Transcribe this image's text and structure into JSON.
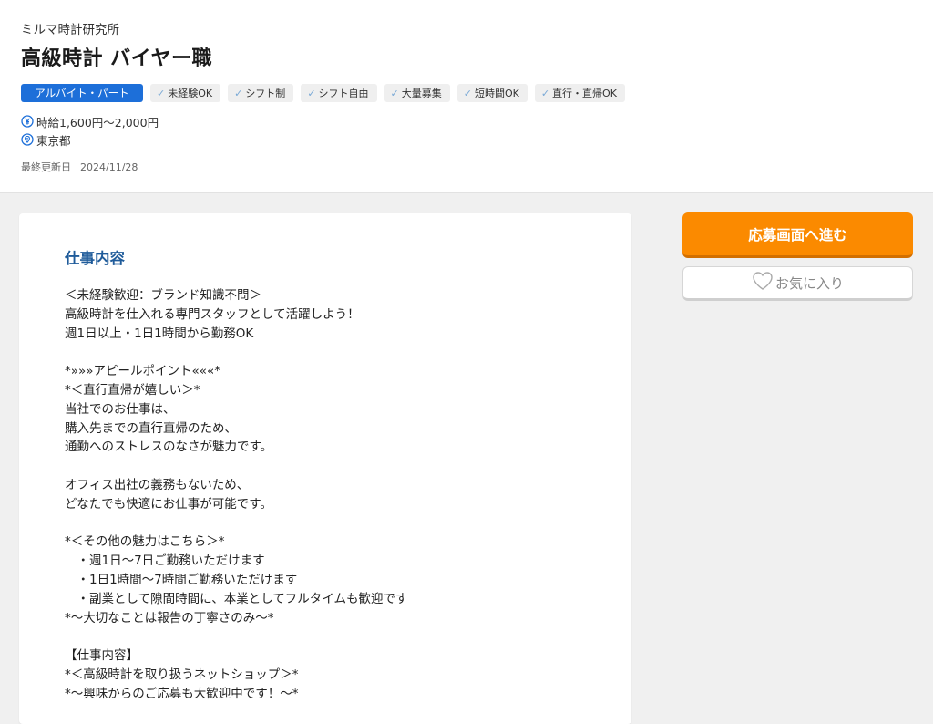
{
  "header": {
    "company": "ミルマ時計研究所",
    "job_title": "高級時計 バイヤー職",
    "employment_type": "アルバイト・パート",
    "tags": [
      "未経験OK",
      "シフト制",
      "シフト自由",
      "大量募集",
      "短時間OK",
      "直行・直帰OK"
    ],
    "salary": "時給1,600円〜2,000円",
    "location": "東京都",
    "updated_label": "最終更新日",
    "updated_date": "2024/11/28"
  },
  "main": {
    "section_title": "仕事内容",
    "lines": [
      "＜未経験歓迎：ブランド知識不問＞",
      "高級時計を仕入れる専門スタッフとして活躍しよう！",
      "週1日以上・1日1時間から勤務OK",
      "",
      "*»»»アピールポイント«««*",
      "*＜直行直帰が嬉しい＞*",
      "当社でのお仕事は、",
      "購入先までの直行直帰のため、",
      "通勤へのストレスのなさが魅力です。",
      "",
      "オフィス出社の義務もないため、",
      "どなたでも快適にお仕事が可能です。",
      "",
      "*＜その他の魅力はこちら＞*",
      "　・週1日〜7日ご勤務いただけます",
      "　・1日1時間〜7時間ご勤務いただけます",
      "　・副業として隙間時間に、本業としてフルタイムも歓迎です",
      "*〜大切なことは報告の丁寧さのみ〜*",
      "",
      "【仕事内容】",
      "*＜高級時計を取り扱うネットショップ＞*",
      "*〜興味からのご応募も大歓迎中です！〜*"
    ]
  },
  "actions": {
    "apply_label": "応募画面へ進む",
    "favorite_label": "お気に入り"
  },
  "colors": {
    "accent_blue": "#1d6fd9",
    "section_title": "#1f5b9a",
    "apply_orange": "#fb8a00"
  },
  "icons": {
    "salary": "yen-icon",
    "location": "location-pin-icon",
    "tag_check": "check-icon",
    "favorite": "heart-outline-icon"
  }
}
